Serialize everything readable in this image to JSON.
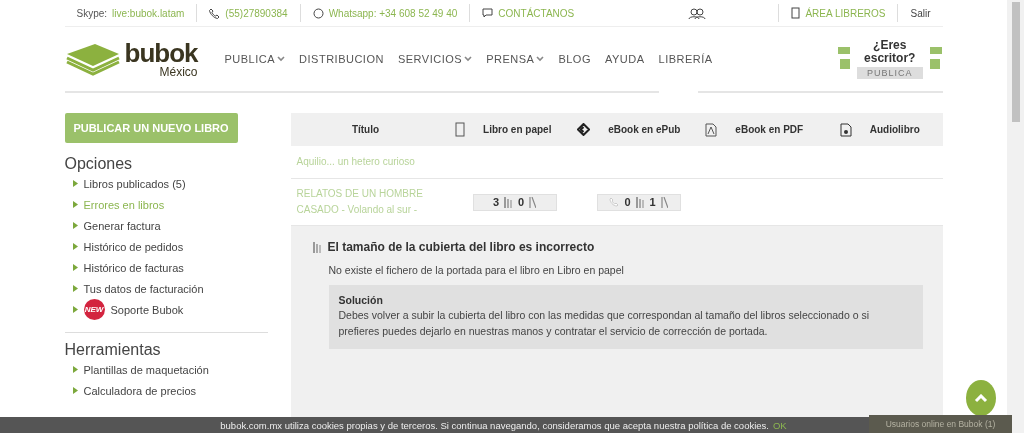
{
  "topbar": {
    "skype_label": "Skype:",
    "skype_link": "live:bubok.latam",
    "phone": "(55)27890384",
    "whatsapp": "Whatsapp: +34 608 52 49 40",
    "contact": "CONTÁCTANOS",
    "area": "ÁREA LIBREROS",
    "logout": "Salir"
  },
  "header": {
    "logo": {
      "name": "bubok",
      "region": "México"
    },
    "nav": [
      {
        "label": "PUBLICA",
        "dropdown": true
      },
      {
        "label": "DISTRIBUCION",
        "dropdown": false
      },
      {
        "label": "SERVICIOS",
        "dropdown": true
      },
      {
        "label": "PRENSA",
        "dropdown": true
      },
      {
        "label": "BLOG",
        "dropdown": false
      },
      {
        "label": "AYUDA",
        "dropdown": false
      },
      {
        "label": "LIBRERÍA",
        "dropdown": false
      }
    ],
    "promo": {
      "line1": "¿Eres",
      "line2": "escritor?",
      "button": "PUBLICA"
    }
  },
  "sidebar": {
    "publish_button": "PUBLICAR UN NUEVO LIBRO",
    "sections": [
      {
        "title": "Opciones",
        "items": [
          {
            "label": "Libros publicados (5)",
            "selected": false
          },
          {
            "label": "Errores en libros",
            "selected": true
          },
          {
            "label": "Generar factura",
            "selected": false
          },
          {
            "label": "Histórico de pedidos",
            "selected": false
          },
          {
            "label": "Histórico de facturas",
            "selected": false
          },
          {
            "label": "Tus datos de facturación",
            "selected": false
          },
          {
            "label": "Soporte Bubok",
            "selected": false,
            "badge": "NEW"
          }
        ]
      },
      {
        "title": "Herramientas",
        "items": [
          {
            "label": "Plantillas de maquetación",
            "selected": false
          },
          {
            "label": "Calculadora de precios",
            "selected": false
          }
        ]
      }
    ]
  },
  "table": {
    "columns": [
      {
        "label": "Título",
        "kind": "plain"
      },
      {
        "label": "Libro en papel",
        "kind": "paper"
      },
      {
        "label": "eBook en ePub",
        "kind": "epub"
      },
      {
        "label": "eBook en PDF",
        "kind": "pdf"
      },
      {
        "label": "Audiolibro",
        "kind": "audio"
      }
    ],
    "rows": [
      {
        "title": "Aquilio... un hetero curioso",
        "pills": []
      },
      {
        "title": "RELATOS DE UN HOMBRE CASADO - Volando al sur -",
        "pills": [
          {
            "kind": "paper",
            "values": [
              "3",
              "0"
            ]
          },
          {
            "kind": "phone",
            "values": [
              "0",
              "1"
            ]
          }
        ]
      }
    ]
  },
  "errors": [
    {
      "title": "El tamaño de la cubierta del libro es incorrecto",
      "description": "No existe el fichero de la portada para el libro en Libro en papel",
      "solution_title": "Solución",
      "solution_text": "Debes volver a subir la cubierta del libro con las medidas que correspondan al tamaño del libros seleccionado o si prefieres puedes dejarlo en nuestras manos y contratar el servicio de corrección de portada."
    }
  ],
  "cookie": {
    "text": "bubok.com.mx utiliza cookies propias y de terceros. Si continua navegando, consideramos que acepta nuestra política de cookies.",
    "ok": "OK"
  },
  "online": "Usuarios online en Bubok (1)"
}
